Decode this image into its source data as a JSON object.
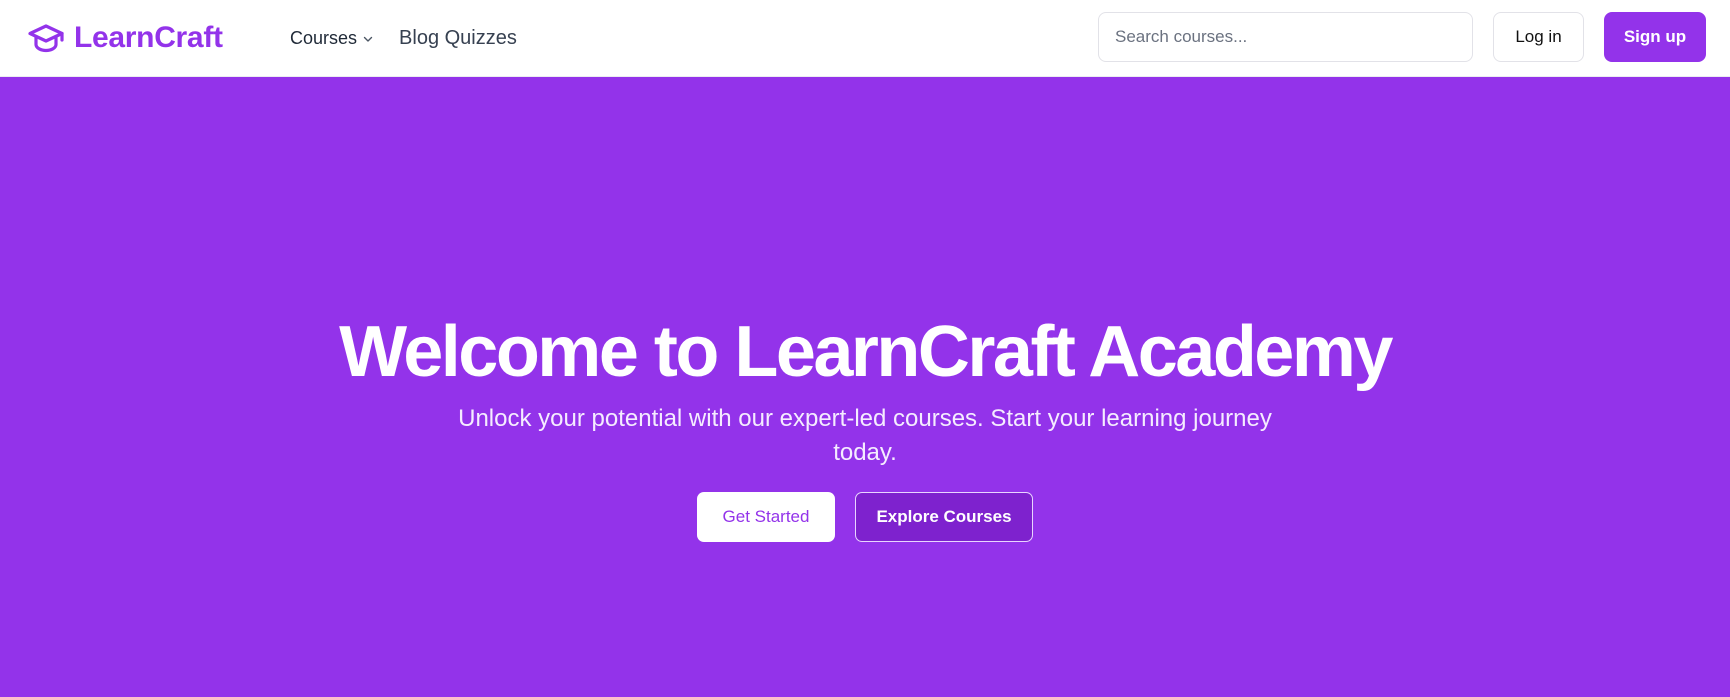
{
  "brand": {
    "name": "LearnCraft",
    "icon": "graduation-cap-icon",
    "color": "#9333ea"
  },
  "nav": {
    "courses_label": "Courses",
    "courses_icon": "chevron-down-icon",
    "blog_quizzes_label": "Blog Quizzes"
  },
  "search": {
    "placeholder": "Search courses...",
    "value": ""
  },
  "auth": {
    "login_label": "Log in",
    "signup_label": "Sign up"
  },
  "hero": {
    "title": "Welcome to LearnCraft Academy",
    "subtitle": "Unlock your potential with our expert-led courses. Start your learning journey today.",
    "primary_cta": "Get Started",
    "secondary_cta": "Explore Courses",
    "background_color": "#9333ea"
  },
  "colors": {
    "accent": "#9333ea",
    "accent_dark": "#7e22ce",
    "white": "#ffffff"
  }
}
